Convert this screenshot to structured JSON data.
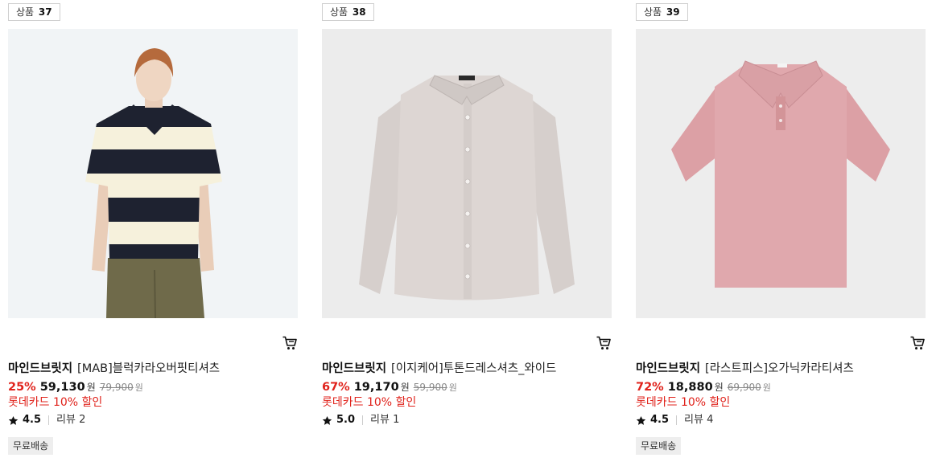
{
  "products": [
    {
      "badge_label": "상품",
      "badge_number": "37",
      "brand": "마인드브릿지",
      "name": "[MAB]블럭카라오버핏티셔츠",
      "discount_rate": "25%",
      "sale_price": "59,130",
      "currency": "원",
      "original_price": "79,900",
      "promo": "롯데카드 10% 할인",
      "rating": "4.5",
      "review_label": "리뷰 2",
      "tag": "무료배송"
    },
    {
      "badge_label": "상품",
      "badge_number": "38",
      "brand": "마인드브릿지",
      "name": "[이지케어]투톤드레스셔츠_와이드",
      "discount_rate": "67%",
      "sale_price": "19,170",
      "currency": "원",
      "original_price": "59,900",
      "promo": "롯데카드 10% 할인",
      "rating": "5.0",
      "review_label": "리뷰 1"
    },
    {
      "badge_label": "상품",
      "badge_number": "39",
      "brand": "마인드브릿지",
      "name": "[라스트피스]오가닉카라티셔츠",
      "discount_rate": "72%",
      "sale_price": "18,880",
      "currency": "원",
      "original_price": "69,900",
      "promo": "롯데카드 10% 할인",
      "rating": "4.5",
      "review_label": "리뷰 4",
      "tag": "무료배송"
    }
  ],
  "icons": {
    "cart": "cart-icon",
    "star": "star-icon"
  },
  "colors": {
    "discount": "#e0221b",
    "tag_background": "#eeeeee"
  }
}
